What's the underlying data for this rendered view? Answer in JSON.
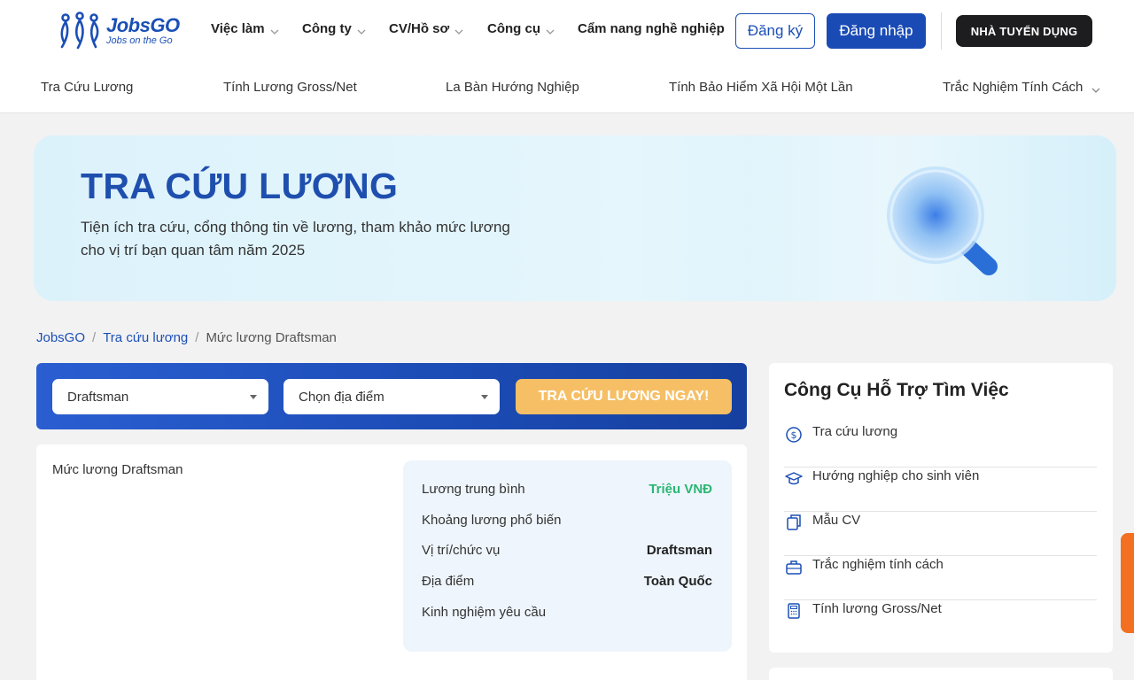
{
  "header": {
    "logo": {
      "name": "JobsGO",
      "tagline": "Jobs on the Go"
    },
    "nav": [
      {
        "label": "Việc làm",
        "has_dropdown": true
      },
      {
        "label": "Công ty",
        "has_dropdown": true
      },
      {
        "label": "CV/Hồ sơ",
        "has_dropdown": true
      },
      {
        "label": "Công cụ",
        "has_dropdown": true
      },
      {
        "label": "Cẩm nang nghề nghiệp",
        "has_dropdown": false
      }
    ],
    "register_label": "Đăng ký",
    "login_label": "Đăng nhập",
    "employer_label": "NHÀ TUYỂN DỤNG"
  },
  "subnav": [
    {
      "label": "Tra Cứu Lương"
    },
    {
      "label": "Tính Lương Gross/Net"
    },
    {
      "label": "La Bàn Hướng Nghiệp"
    },
    {
      "label": "Tính Bảo Hiểm Xã Hội Một Lần"
    },
    {
      "label": "Trắc Nghiệm Tính Cách",
      "has_dropdown": true
    }
  ],
  "hero": {
    "title": "TRA CỨU LƯƠNG",
    "description": "Tiện ích tra cứu, cổng thông tin về lương, tham khảo mức lương cho vị trí bạn quan tâm năm 2025",
    "icon": "magnifier-icon"
  },
  "breadcrumb": {
    "items": [
      "JobsGO",
      "Tra cứu lương"
    ],
    "current": "Mức lương Draftsman",
    "separator": "/"
  },
  "search": {
    "position_value": "Draftsman",
    "location_placeholder": "Chọn địa điểm",
    "button_label": "TRA CỨU LƯƠNG NGAY!"
  },
  "result": {
    "title": "Mức lương Draftsman",
    "rows": [
      {
        "label": "Lương trung bình",
        "value": "Triệu VNĐ"
      },
      {
        "label": "Khoảng lương phổ biến",
        "value": ""
      },
      {
        "label": "Vị trí/chức vụ",
        "value": "Draftsman"
      },
      {
        "label": "Địa điểm",
        "value": "Toàn Quốc"
      },
      {
        "label": "Kinh nghiệm yêu cầu",
        "value": ""
      }
    ]
  },
  "sidebar": {
    "title": "Công Cụ Hỗ Trợ Tìm Việc",
    "items": [
      {
        "label": "Tra cứu lương",
        "icon": "dollar-icon"
      },
      {
        "label": "Hướng nghiệp cho sinh viên",
        "icon": "graduation-cap-icon"
      },
      {
        "label": "Mẫu CV",
        "icon": "document-copy-icon"
      },
      {
        "label": "Trắc nghiệm tính cách",
        "icon": "briefcase-icon"
      },
      {
        "label": "Tính lương Gross/Net",
        "icon": "calculator-icon"
      }
    ]
  },
  "colors": {
    "brand_blue": "#1b4fb6",
    "employer_button": "#1d1d1f",
    "search_button": "#f6bf66",
    "salary_green": "#2bb673",
    "float_tab": "#f36f21"
  }
}
